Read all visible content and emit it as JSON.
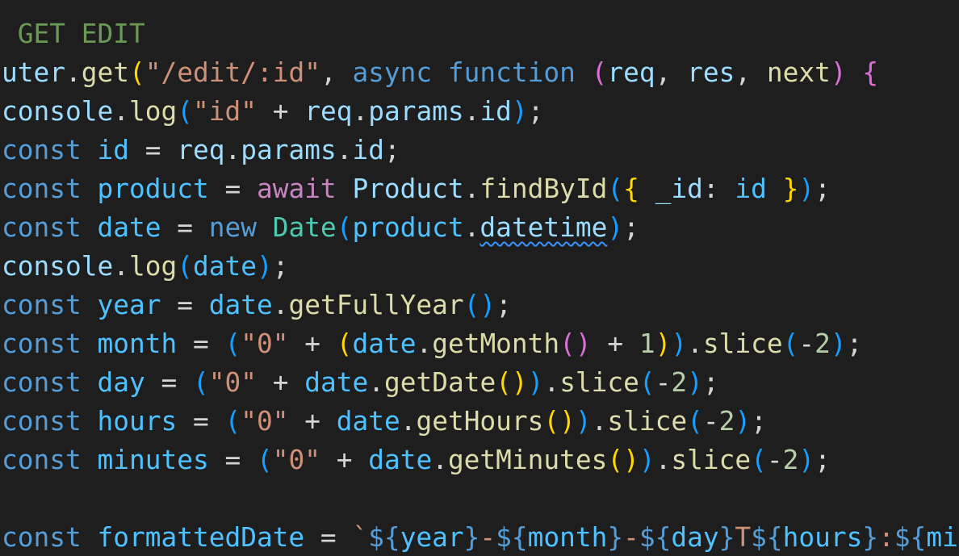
{
  "editor": {
    "theme": {
      "background": "#1e1e1e",
      "default_text": "#d4d4d4",
      "comment": "#6a9955",
      "keyword": "#569cd6",
      "control_keyword": "#c586c0",
      "function": "#dcdcaa",
      "variable": "#9cdcfe",
      "constant": "#4fc1ff",
      "string": "#ce9178",
      "number": "#b5cea8",
      "class": "#4ec9b0",
      "bracket_gold": "#ffd700",
      "bracket_orchid": "#da70d6",
      "bracket_blue": "#179fff",
      "squiggle": "#3794ff"
    },
    "lines": [
      [
        {
          "t": " GET EDIT",
          "c": "comment"
        }
      ],
      [
        {
          "t": "uter",
          "c": "variable"
        },
        {
          "t": ".",
          "c": "default_text"
        },
        {
          "t": "get",
          "c": "function"
        },
        {
          "t": "(",
          "c": "bracket_gold"
        },
        {
          "t": "\"/edit/:id\"",
          "c": "string"
        },
        {
          "t": ", ",
          "c": "default_text"
        },
        {
          "t": "async",
          "c": "keyword"
        },
        {
          "t": " ",
          "c": "default_text"
        },
        {
          "t": "function",
          "c": "keyword"
        },
        {
          "t": " ",
          "c": "default_text"
        },
        {
          "t": "(",
          "c": "bracket_orchid"
        },
        {
          "t": "req",
          "c": "variable"
        },
        {
          "t": ", ",
          "c": "default_text"
        },
        {
          "t": "res",
          "c": "variable"
        },
        {
          "t": ", ",
          "c": "default_text"
        },
        {
          "t": "next",
          "c": "function"
        },
        {
          "t": ")",
          "c": "bracket_orchid"
        },
        {
          "t": " ",
          "c": "default_text"
        },
        {
          "t": "{",
          "c": "bracket_orchid"
        }
      ],
      [
        {
          "t": "console",
          "c": "variable"
        },
        {
          "t": ".",
          "c": "default_text"
        },
        {
          "t": "log",
          "c": "function"
        },
        {
          "t": "(",
          "c": "bracket_blue"
        },
        {
          "t": "\"id\"",
          "c": "string"
        },
        {
          "t": " + ",
          "c": "default_text"
        },
        {
          "t": "req",
          "c": "variable"
        },
        {
          "t": ".",
          "c": "default_text"
        },
        {
          "t": "params",
          "c": "variable"
        },
        {
          "t": ".",
          "c": "default_text"
        },
        {
          "t": "id",
          "c": "variable"
        },
        {
          "t": ")",
          "c": "bracket_blue"
        },
        {
          "t": ";",
          "c": "default_text"
        }
      ],
      [
        {
          "t": "const",
          "c": "keyword"
        },
        {
          "t": " ",
          "c": "default_text"
        },
        {
          "t": "id",
          "c": "constant"
        },
        {
          "t": " = ",
          "c": "default_text"
        },
        {
          "t": "req",
          "c": "variable"
        },
        {
          "t": ".",
          "c": "default_text"
        },
        {
          "t": "params",
          "c": "variable"
        },
        {
          "t": ".",
          "c": "default_text"
        },
        {
          "t": "id",
          "c": "variable"
        },
        {
          "t": ";",
          "c": "default_text"
        }
      ],
      [
        {
          "t": "const",
          "c": "keyword"
        },
        {
          "t": " ",
          "c": "default_text"
        },
        {
          "t": "product",
          "c": "constant"
        },
        {
          "t": " = ",
          "c": "default_text"
        },
        {
          "t": "await",
          "c": "control_keyword"
        },
        {
          "t": " ",
          "c": "default_text"
        },
        {
          "t": "Product",
          "c": "variable"
        },
        {
          "t": ".",
          "c": "default_text"
        },
        {
          "t": "findById",
          "c": "function"
        },
        {
          "t": "(",
          "c": "bracket_blue"
        },
        {
          "t": "{",
          "c": "bracket_gold"
        },
        {
          "t": " ",
          "c": "default_text"
        },
        {
          "t": "_id",
          "c": "variable"
        },
        {
          "t": ": ",
          "c": "default_text"
        },
        {
          "t": "id",
          "c": "constant"
        },
        {
          "t": " ",
          "c": "default_text"
        },
        {
          "t": "}",
          "c": "bracket_gold"
        },
        {
          "t": ")",
          "c": "bracket_blue"
        },
        {
          "t": ";",
          "c": "default_text"
        }
      ],
      [
        {
          "t": "const",
          "c": "keyword"
        },
        {
          "t": " ",
          "c": "default_text"
        },
        {
          "t": "date",
          "c": "constant"
        },
        {
          "t": " = ",
          "c": "default_text"
        },
        {
          "t": "new",
          "c": "keyword"
        },
        {
          "t": " ",
          "c": "default_text"
        },
        {
          "t": "Date",
          "c": "class"
        },
        {
          "t": "(",
          "c": "bracket_blue"
        },
        {
          "t": "product",
          "c": "constant"
        },
        {
          "t": ".",
          "c": "default_text"
        },
        {
          "t": "datetime",
          "c": "variable",
          "squiggle": true
        },
        {
          "t": ")",
          "c": "bracket_blue"
        },
        {
          "t": ";",
          "c": "default_text"
        }
      ],
      [
        {
          "t": "console",
          "c": "variable"
        },
        {
          "t": ".",
          "c": "default_text"
        },
        {
          "t": "log",
          "c": "function"
        },
        {
          "t": "(",
          "c": "bracket_blue"
        },
        {
          "t": "date",
          "c": "constant"
        },
        {
          "t": ")",
          "c": "bracket_blue"
        },
        {
          "t": ";",
          "c": "default_text"
        }
      ],
      [
        {
          "t": "const",
          "c": "keyword"
        },
        {
          "t": " ",
          "c": "default_text"
        },
        {
          "t": "year",
          "c": "constant"
        },
        {
          "t": " = ",
          "c": "default_text"
        },
        {
          "t": "date",
          "c": "constant"
        },
        {
          "t": ".",
          "c": "default_text"
        },
        {
          "t": "getFullYear",
          "c": "function"
        },
        {
          "t": "()",
          "c": "bracket_blue"
        },
        {
          "t": ";",
          "c": "default_text"
        }
      ],
      [
        {
          "t": "const",
          "c": "keyword"
        },
        {
          "t": " ",
          "c": "default_text"
        },
        {
          "t": "month",
          "c": "constant"
        },
        {
          "t": " = ",
          "c": "default_text"
        },
        {
          "t": "(",
          "c": "bracket_blue"
        },
        {
          "t": "\"0\"",
          "c": "string"
        },
        {
          "t": " + ",
          "c": "default_text"
        },
        {
          "t": "(",
          "c": "bracket_gold"
        },
        {
          "t": "date",
          "c": "constant"
        },
        {
          "t": ".",
          "c": "default_text"
        },
        {
          "t": "getMonth",
          "c": "function"
        },
        {
          "t": "()",
          "c": "bracket_orchid"
        },
        {
          "t": " + ",
          "c": "default_text"
        },
        {
          "t": "1",
          "c": "number"
        },
        {
          "t": ")",
          "c": "bracket_gold"
        },
        {
          "t": ")",
          "c": "bracket_blue"
        },
        {
          "t": ".",
          "c": "default_text"
        },
        {
          "t": "slice",
          "c": "function"
        },
        {
          "t": "(",
          "c": "bracket_blue"
        },
        {
          "t": "-",
          "c": "default_text"
        },
        {
          "t": "2",
          "c": "number"
        },
        {
          "t": ")",
          "c": "bracket_blue"
        },
        {
          "t": ";",
          "c": "default_text"
        }
      ],
      [
        {
          "t": "const",
          "c": "keyword"
        },
        {
          "t": " ",
          "c": "default_text"
        },
        {
          "t": "day",
          "c": "constant"
        },
        {
          "t": " = ",
          "c": "default_text"
        },
        {
          "t": "(",
          "c": "bracket_blue"
        },
        {
          "t": "\"0\"",
          "c": "string"
        },
        {
          "t": " + ",
          "c": "default_text"
        },
        {
          "t": "date",
          "c": "constant"
        },
        {
          "t": ".",
          "c": "default_text"
        },
        {
          "t": "getDate",
          "c": "function"
        },
        {
          "t": "()",
          "c": "bracket_gold"
        },
        {
          "t": ")",
          "c": "bracket_blue"
        },
        {
          "t": ".",
          "c": "default_text"
        },
        {
          "t": "slice",
          "c": "function"
        },
        {
          "t": "(",
          "c": "bracket_blue"
        },
        {
          "t": "-",
          "c": "default_text"
        },
        {
          "t": "2",
          "c": "number"
        },
        {
          "t": ")",
          "c": "bracket_blue"
        },
        {
          "t": ";",
          "c": "default_text"
        }
      ],
      [
        {
          "t": "const",
          "c": "keyword"
        },
        {
          "t": " ",
          "c": "default_text"
        },
        {
          "t": "hours",
          "c": "constant"
        },
        {
          "t": " = ",
          "c": "default_text"
        },
        {
          "t": "(",
          "c": "bracket_blue"
        },
        {
          "t": "\"0\"",
          "c": "string"
        },
        {
          "t": " + ",
          "c": "default_text"
        },
        {
          "t": "date",
          "c": "constant"
        },
        {
          "t": ".",
          "c": "default_text"
        },
        {
          "t": "getHours",
          "c": "function"
        },
        {
          "t": "()",
          "c": "bracket_gold"
        },
        {
          "t": ")",
          "c": "bracket_blue"
        },
        {
          "t": ".",
          "c": "default_text"
        },
        {
          "t": "slice",
          "c": "function"
        },
        {
          "t": "(",
          "c": "bracket_blue"
        },
        {
          "t": "-",
          "c": "default_text"
        },
        {
          "t": "2",
          "c": "number"
        },
        {
          "t": ")",
          "c": "bracket_blue"
        },
        {
          "t": ";",
          "c": "default_text"
        }
      ],
      [
        {
          "t": "const",
          "c": "keyword"
        },
        {
          "t": " ",
          "c": "default_text"
        },
        {
          "t": "minutes",
          "c": "constant"
        },
        {
          "t": " = ",
          "c": "default_text"
        },
        {
          "t": "(",
          "c": "bracket_blue"
        },
        {
          "t": "\"0\"",
          "c": "string"
        },
        {
          "t": " + ",
          "c": "default_text"
        },
        {
          "t": "date",
          "c": "constant"
        },
        {
          "t": ".",
          "c": "default_text"
        },
        {
          "t": "getMinutes",
          "c": "function"
        },
        {
          "t": "()",
          "c": "bracket_gold"
        },
        {
          "t": ")",
          "c": "bracket_blue"
        },
        {
          "t": ".",
          "c": "default_text"
        },
        {
          "t": "slice",
          "c": "function"
        },
        {
          "t": "(",
          "c": "bracket_blue"
        },
        {
          "t": "-",
          "c": "default_text"
        },
        {
          "t": "2",
          "c": "number"
        },
        {
          "t": ")",
          "c": "bracket_blue"
        },
        {
          "t": ";",
          "c": "default_text"
        }
      ],
      [],
      [
        {
          "t": "const",
          "c": "keyword"
        },
        {
          "t": " ",
          "c": "default_text"
        },
        {
          "t": "formattedDate",
          "c": "constant"
        },
        {
          "t": " = ",
          "c": "default_text"
        },
        {
          "t": "`",
          "c": "string"
        },
        {
          "t": "${",
          "c": "keyword"
        },
        {
          "t": "year",
          "c": "constant"
        },
        {
          "t": "}",
          "c": "keyword"
        },
        {
          "t": "-",
          "c": "string"
        },
        {
          "t": "${",
          "c": "keyword"
        },
        {
          "t": "month",
          "c": "constant"
        },
        {
          "t": "}",
          "c": "keyword"
        },
        {
          "t": "-",
          "c": "string"
        },
        {
          "t": "${",
          "c": "keyword"
        },
        {
          "t": "day",
          "c": "constant"
        },
        {
          "t": "}",
          "c": "keyword"
        },
        {
          "t": "T",
          "c": "string"
        },
        {
          "t": "${",
          "c": "keyword"
        },
        {
          "t": "hours",
          "c": "constant"
        },
        {
          "t": "}",
          "c": "keyword"
        },
        {
          "t": ":",
          "c": "string"
        },
        {
          "t": "${",
          "c": "keyword"
        },
        {
          "t": "mi",
          "c": "constant"
        }
      ]
    ]
  }
}
